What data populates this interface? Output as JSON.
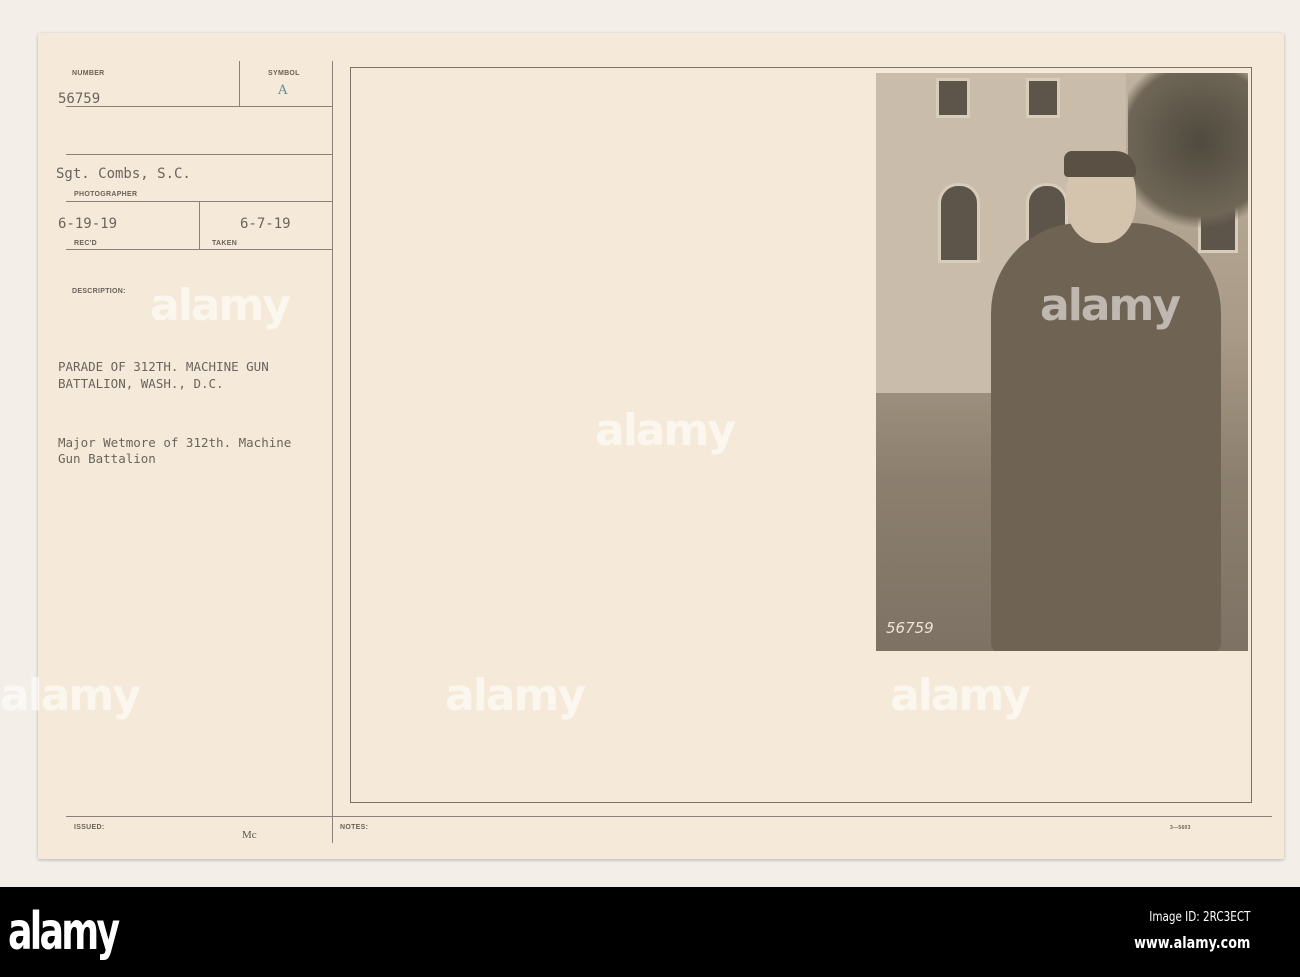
{
  "record": {
    "number_label": "NUMBER",
    "number": "56759",
    "symbol_label": "SYMBOL",
    "symbol": "A",
    "photographer": "Sgt. Combs, S.C.",
    "photographer_label": "PHOTOGRAPHER",
    "received": "6-19-19",
    "received_label": "REC'D",
    "taken": "6-7-19",
    "taken_label": "TAKEN",
    "description_label": "DESCRIPTION:",
    "description_line1": "PARADE OF 312TH. MACHINE GUN",
    "description_line2": "BATTALION, WASH., D.C.",
    "caption_line1": "Major Wetmore of 312th. Machine",
    "caption_line2": "Gun Battalion",
    "issued_label": "ISSUED:",
    "issued": "Mc",
    "notes_label": "NOTES:",
    "form_number": "3—5603"
  },
  "photo": {
    "number": "56759"
  },
  "watermark": "alamy",
  "footer": {
    "logo": "alamy",
    "image_id": "Image ID: 2RC3ECT",
    "url": "www.alamy.com"
  }
}
